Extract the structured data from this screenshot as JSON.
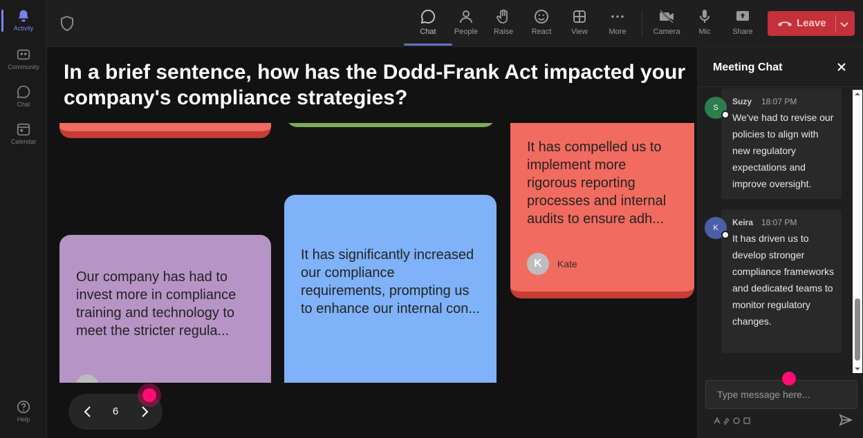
{
  "rail": {
    "items": [
      {
        "label": "Activity",
        "icon": "bell-icon",
        "active": true
      },
      {
        "label": "Community",
        "icon": "community-icon",
        "active": false
      },
      {
        "label": "Chat",
        "icon": "chat-icon",
        "active": false
      },
      {
        "label": "Calendar",
        "icon": "calendar-icon",
        "active": false
      }
    ],
    "help": {
      "label": "Help",
      "icon": "help-icon"
    }
  },
  "toolbar": {
    "buttons": [
      {
        "label": "Chat",
        "icon": "chat-bubble-icon",
        "active": true
      },
      {
        "label": "People",
        "icon": "people-icon",
        "active": false
      },
      {
        "label": "Raise",
        "icon": "raise-hand-icon",
        "active": false
      },
      {
        "label": "React",
        "icon": "smiley-icon",
        "active": false
      },
      {
        "label": "View",
        "icon": "grid-view-icon",
        "active": false
      },
      {
        "label": "More",
        "icon": "more-dots-icon",
        "active": false
      },
      {
        "label": "Camera",
        "icon": "camera-off-icon",
        "active": false
      },
      {
        "label": "Mic",
        "icon": "mic-icon",
        "active": false
      },
      {
        "label": "Share",
        "icon": "share-screen-icon",
        "active": false
      }
    ],
    "leave_label": "Leave",
    "leave_color": "#c4313b"
  },
  "main": {
    "question": "In a brief sentence, how has the Dodd-Frank Act impacted your company's compliance strategies?",
    "cards": [
      {
        "text": "It has compelled us to implement more rigorous reporting processes and internal audits to ensure adh...",
        "author_initial": "K",
        "author_name": "Kate",
        "color": "#f26b60"
      },
      {
        "text": "Our company has had to invest more in compliance training and technology to meet the stricter regula...",
        "author_initial": "",
        "author_name": "",
        "color": "#b794c6"
      },
      {
        "text": "It has significantly increased our compliance requirements, prompting us to enhance our internal con...",
        "author_initial": "",
        "author_name": "",
        "color": "#7fb2f8"
      }
    ],
    "pager": {
      "page": "6"
    }
  },
  "chat": {
    "title": "Meeting Chat",
    "messages": [
      {
        "initial": "S",
        "name": "Suzy",
        "time": "18:07 PM",
        "body": "We've had to revise our policies to align with new regulatory expectations and improve oversight.",
        "avatar_color": "#2e7d4f"
      },
      {
        "initial": "K",
        "name": "Keira",
        "time": "18:07 PM",
        "body": "It has driven us to develop stronger compliance frameworks and dedicated teams to monitor regulatory changes.",
        "avatar_color": "#4b5fa6"
      }
    ],
    "compose_placeholder": "Type message here..."
  }
}
